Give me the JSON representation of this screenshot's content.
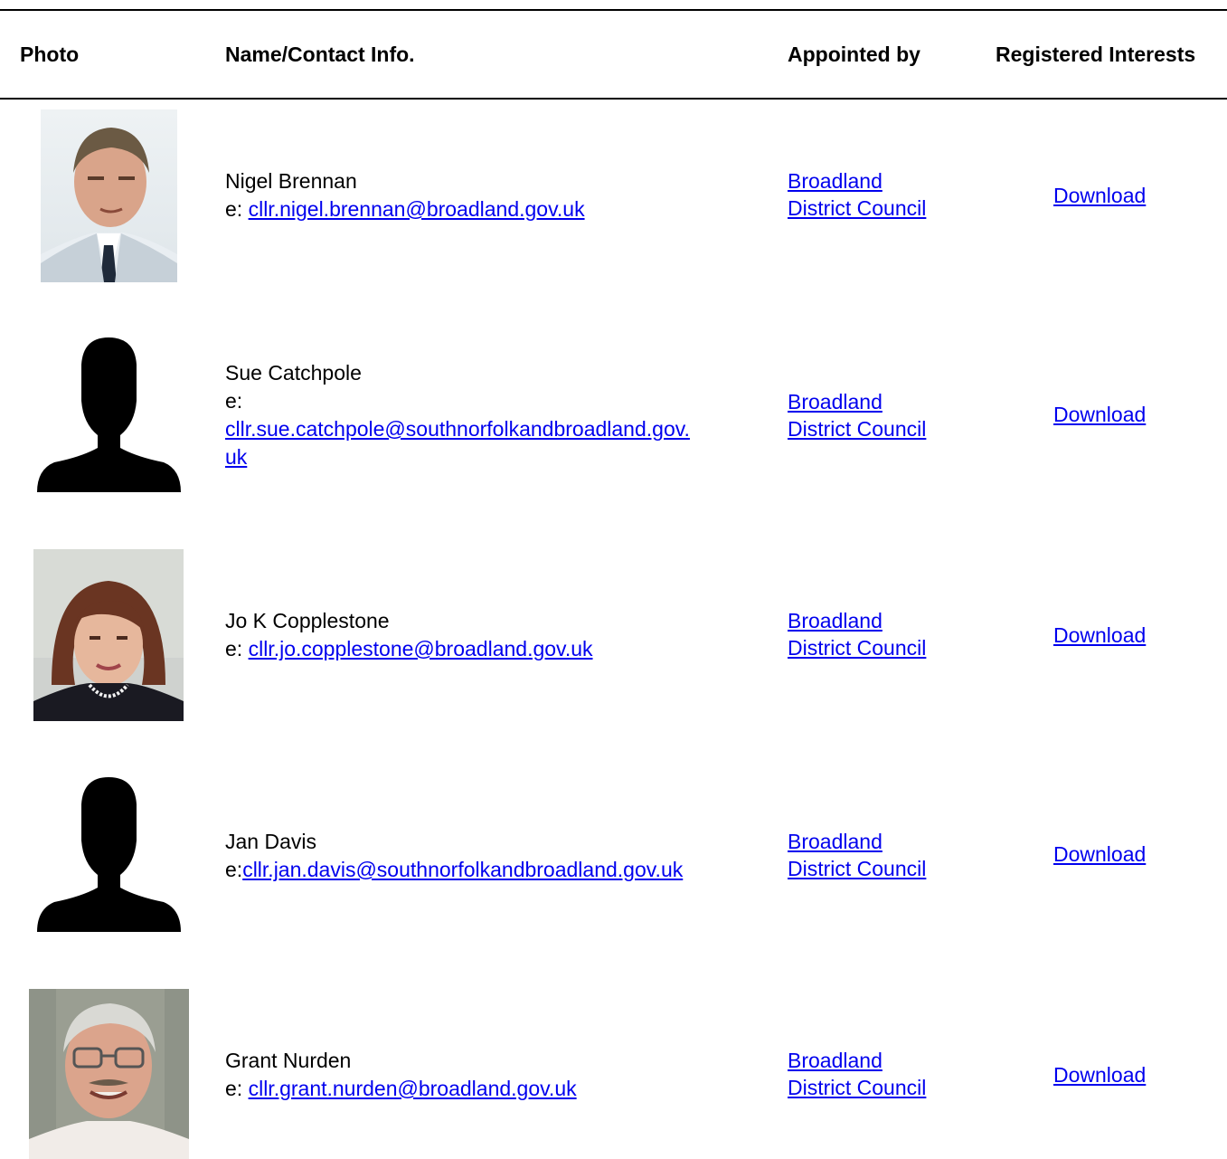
{
  "header": {
    "photo": "Photo",
    "name_contact": "Name/Contact Info.",
    "appointed_by": "Appointed by",
    "registered_interests": "Registered Interests"
  },
  "members": [
    {
      "name": "Nigel Brennan",
      "email_prefix": "e: ",
      "email": "cllr.nigel.brennan@broadland.gov.uk",
      "appointed_line1": "Broadland",
      "appointed_line2": "District Council",
      "download": "Download",
      "photo_type": "portrait-man-suit"
    },
    {
      "name": "Sue Catchpole",
      "email_prefix": "e:",
      "email_part1": "cllr.sue.catchpole@southnorfolkandbroadland.gov.",
      "email_part2": "uk",
      "appointed_line1": "Broadland",
      "appointed_line2": "District Council",
      "download": "Download",
      "photo_type": "silhouette-icon"
    },
    {
      "name": "Jo K Copplestone",
      "email_prefix": "e: ",
      "email": "cllr.jo.copplestone@broadland.gov.uk",
      "appointed_line1": "Broadland",
      "appointed_line2": "District Council",
      "download": "Download",
      "photo_type": "portrait-woman"
    },
    {
      "name": "Jan Davis",
      "email_prefix": "e:",
      "email": "cllr.jan.davis@southnorfolkandbroadland.gov.uk",
      "appointed_line1": "Broadland",
      "appointed_line2": "District Council",
      "download": "Download",
      "photo_type": "silhouette-icon"
    },
    {
      "name": "Grant Nurden",
      "email_prefix": "e: ",
      "email": "cllr.grant.nurden@broadland.gov.uk",
      "appointed_line1": "Broadland",
      "appointed_line2": "District Council",
      "download": "Download",
      "photo_type": "portrait-man-glasses"
    }
  ],
  "colors": {
    "link": "#0000ee",
    "rule": "#000000",
    "text": "#000000"
  }
}
